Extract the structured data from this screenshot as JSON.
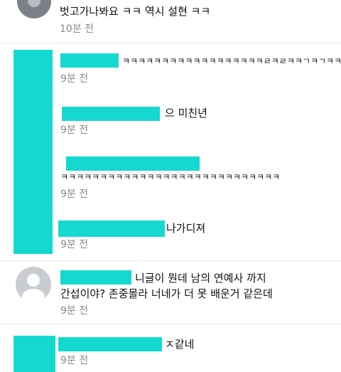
{
  "comments": [
    {
      "text": "벗고가나봐요 ㅋㅋ 역시 설현 ㅋㅋ",
      "time": "10분 전"
    },
    {
      "text": "ㅋㅋㅋㅋㅋㅋㅋㅋㅋㅋㅋㅋㅋㅋㅋㅋㅋㅋㄹㅋㄹㅋㅋㄱㅋㄱㅋㅋㅋ",
      "time": "9분 전"
    },
    {
      "text": "으 미친년",
      "time": "9분 전"
    },
    {
      "text": "ㅋㅋㅋㅋㅋㅋㅋㅋㅋㅋㅋㅋㅋㅋㅋㅋㅋㅋㅋㅋㅋㅋㅋㅋㅋㅋㅋㅋ",
      "time": "9분 전"
    },
    {
      "text": "나가디져",
      "time": "9분 전"
    },
    {
      "line1": "니글이 뭔데 남의 연예사 까지",
      "line2": "간섭이야? 존중몰라 너네가 더 못 배운거 같은데",
      "time": "9분 전"
    },
    {
      "text": "ㅈ같네",
      "time": "9분 전"
    }
  ],
  "colors": {
    "redaction": "#15d9d0",
    "timestamp": "#8a8a8a",
    "avatar": "#c9ccd1"
  },
  "icons": {
    "avatar": "default-user-avatar-icon"
  }
}
